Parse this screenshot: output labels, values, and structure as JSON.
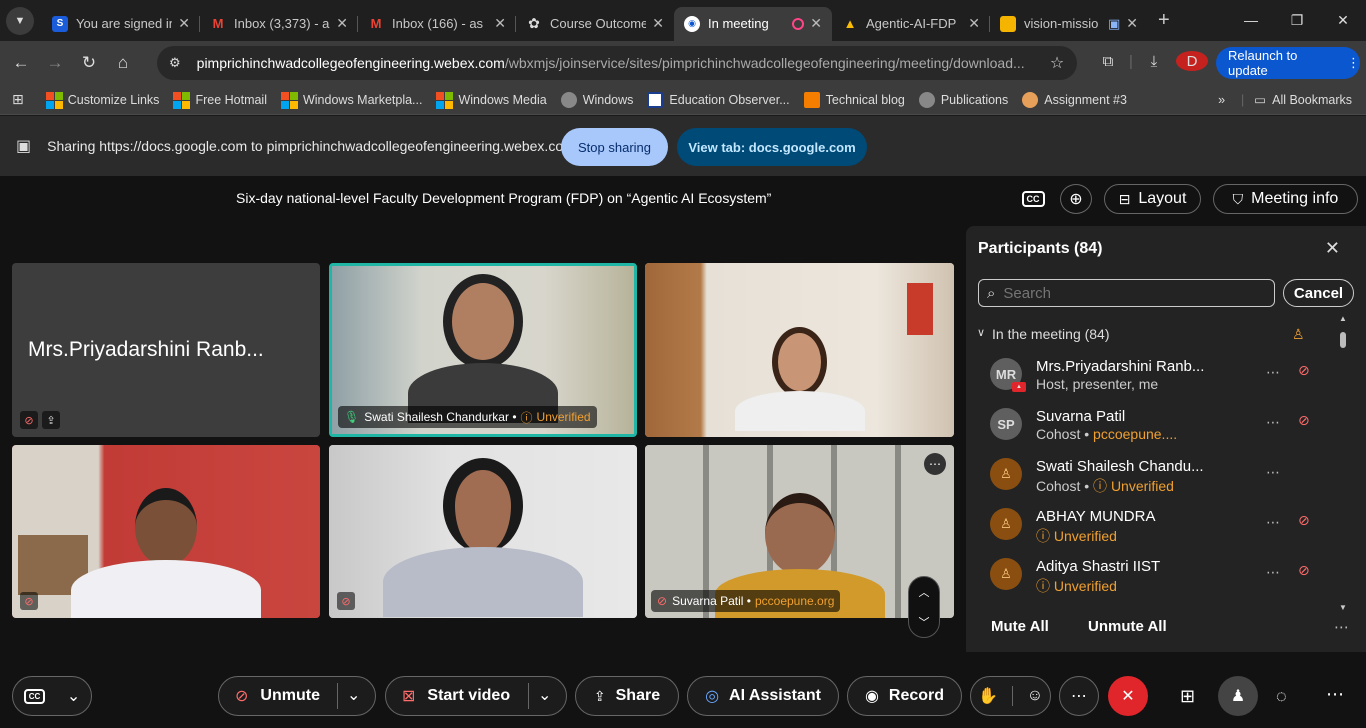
{
  "browser": {
    "tabs": [
      {
        "title": "You are signed in",
        "favicon": "s-icon",
        "active": false
      },
      {
        "title": "Inbox (3,373) - a",
        "favicon": "gmail-icon",
        "active": false
      },
      {
        "title": "Inbox (166) - as",
        "favicon": "gmail-icon",
        "active": false
      },
      {
        "title": "Course Outcome",
        "favicon": "chatgpt-icon",
        "active": false
      },
      {
        "title": "In meeting",
        "favicon": "webex-icon",
        "active": true
      },
      {
        "title": "Agentic-AI-FDP",
        "favicon": "drive-icon",
        "active": false
      },
      {
        "title": "vision-missio",
        "favicon": "slides-icon",
        "active": false
      }
    ],
    "address": {
      "domain": "pimprichinchwadcollegeofengineering.webex.com",
      "path": "/wbxmjs/joinservice/sites/pimprichinchwadcollegeofengineering/meeting/download..."
    },
    "profile_initial": "D",
    "relaunch_label": "Relaunch to update",
    "bookmarks": [
      {
        "label": "Customize Links"
      },
      {
        "label": "Free Hotmail"
      },
      {
        "label": "Windows Marketpla..."
      },
      {
        "label": "Windows Media"
      },
      {
        "label": "Windows"
      },
      {
        "label": "Education Observer..."
      },
      {
        "label": "Technical blog"
      },
      {
        "label": "Publications"
      },
      {
        "label": "Assignment #3"
      }
    ],
    "all_bookmarks_label": "All Bookmarks"
  },
  "share_bar": {
    "text": "Sharing https://docs.google.com to pimprichinchwadcollegeofengineering.webex.com",
    "stop_label": "Stop sharing",
    "view_label": "View tab: docs.google.com"
  },
  "meeting": {
    "title": "Six-day national-level Faculty Development Program (FDP) on “Agentic AI Ecosystem”",
    "layout_label": "Layout",
    "info_label": "Meeting info",
    "cc_label": "CC",
    "tiles": [
      {
        "name": "Mrs.Priyadarshini Ranb..."
      },
      {
        "name": "Swati Shailesh Chandurkar",
        "sep": "•",
        "status": "Unverified"
      },
      {
        "name": ""
      },
      {
        "name": ""
      },
      {
        "name": ""
      },
      {
        "name": "Suvarna Patil",
        "sep": "•",
        "org": "pccoepune.org"
      }
    ]
  },
  "participants": {
    "title": "Participants (84)",
    "search_placeholder": "Search",
    "cancel_label": "Cancel",
    "section_label": "In the meeting (84)",
    "list": [
      {
        "initials": "MR",
        "name": "Mrs.Priyadarshini Ranb...",
        "sub": "Host, presenter, me",
        "sub2": ""
      },
      {
        "initials": "SP",
        "name": "Suvarna Patil",
        "sub": "Cohost •",
        "sub2": "pccoepune...."
      },
      {
        "initials": "",
        "name": "Swati Shailesh Chandu...",
        "sub": "Cohost •",
        "sub2": "Unverified"
      },
      {
        "initials": "",
        "name": "ABHAY MUNDRA",
        "sub": "",
        "sub2": "Unverified"
      },
      {
        "initials": "",
        "name": "Aditya Shastri IIST",
        "sub": "",
        "sub2": "Unverified"
      }
    ],
    "mute_all_label": "Mute All",
    "unmute_all_label": "Unmute All"
  },
  "controls": {
    "unmute_label": "Unmute",
    "video_label": "Start video",
    "share_label": "Share",
    "ai_label": "AI Assistant",
    "record_label": "Record"
  },
  "colors": {
    "accent": "#0b57d0",
    "unverified": "#f0a030",
    "end_call": "#e0262b",
    "active_speaker": "#1fb6a6"
  }
}
